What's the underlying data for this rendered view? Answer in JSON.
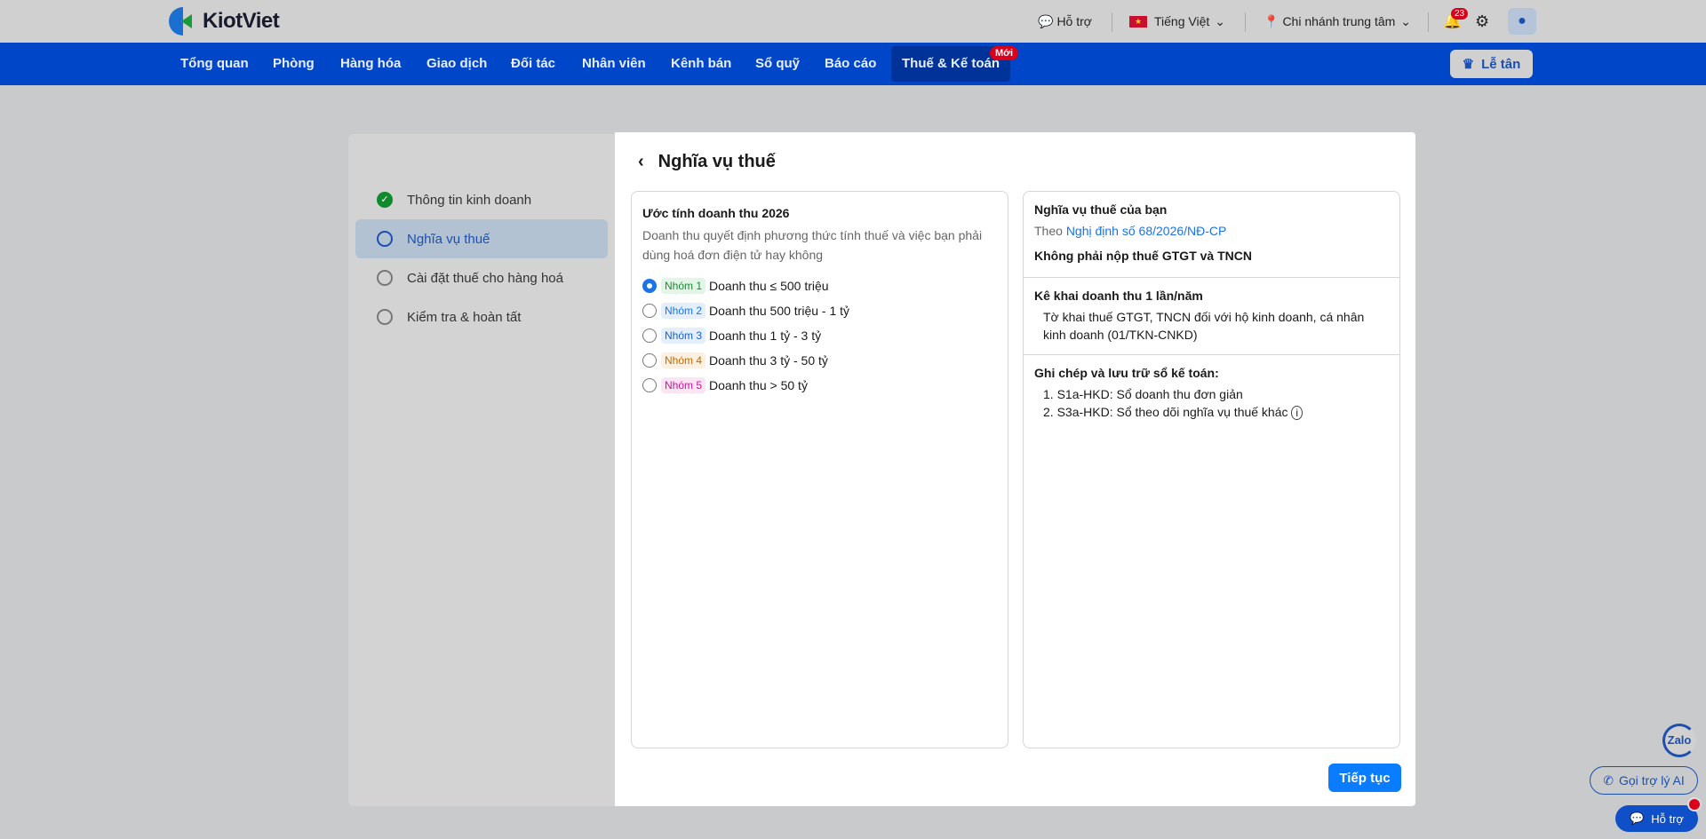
{
  "header": {
    "brand": "KiotViet",
    "support": "Hỗ trợ",
    "language": "Tiếng Việt",
    "branch": "Chi nhánh trung tâm",
    "notification_count": "23"
  },
  "nav": {
    "items": [
      "Tổng quan",
      "Phòng",
      "Hàng hóa",
      "Giao dịch",
      "Đối tác",
      "Nhân viên",
      "Kênh bán",
      "Sổ quỹ",
      "Báo cáo",
      "Thuế & Kế toán"
    ],
    "new_badge": "Mới",
    "reception": "Lễ tân"
  },
  "steps": [
    "Thông tin kinh doanh",
    "Nghĩa vụ thuế",
    "Cài đặt thuế cho hàng hoá",
    "Kiểm tra & hoàn tất"
  ],
  "page": {
    "title": "Nghĩa vụ thuế",
    "continue": "Tiếp tục"
  },
  "estimate": {
    "heading": "Ước tính doanh thu 2026",
    "description": "Doanh thu quyết định phương thức tính thuế và việc bạn phải dùng hoá đơn điện tử hay không",
    "options": [
      {
        "tag": "Nhóm 1",
        "label": "Doanh thu ≤ 500 triệu",
        "selected": true
      },
      {
        "tag": "Nhóm 2",
        "label": "Doanh thu 500 triệu - 1 tỷ"
      },
      {
        "tag": "Nhóm 3",
        "label": "Doanh thu 1 tỷ - 3 tỷ"
      },
      {
        "tag": "Nhóm 4",
        "label": "Doanh thu 3 tỷ - 50 tỷ"
      },
      {
        "tag": "Nhóm 5",
        "label": "Doanh thu > 50 tỷ"
      }
    ]
  },
  "obligations": {
    "heading": "Nghĩa vụ thuế của bạn",
    "per": "Theo",
    "decree": "Nghị định số 68/2026/NĐ-CP",
    "status": "Không phải nộp thuế GTGT và TNCN",
    "declare_heading": "Kê khai doanh thu 1 lần/năm",
    "declare_desc": "Tờ khai thuế GTGT, TNCN đối với hộ kinh doanh, cá nhân kinh doanh (01/TKN-CNKD)",
    "books_heading": "Ghi chép và lưu trữ sổ kế toán:",
    "books": [
      "1. S1a-HKD: Sổ doanh thu đơn giản",
      "2. S3a-HKD: Sổ theo dõi nghĩa vụ thuế khác"
    ]
  },
  "floating": {
    "zalo": "Zalo",
    "ai": "Gọi trợ lý AI",
    "support": "Hỗ trợ"
  }
}
